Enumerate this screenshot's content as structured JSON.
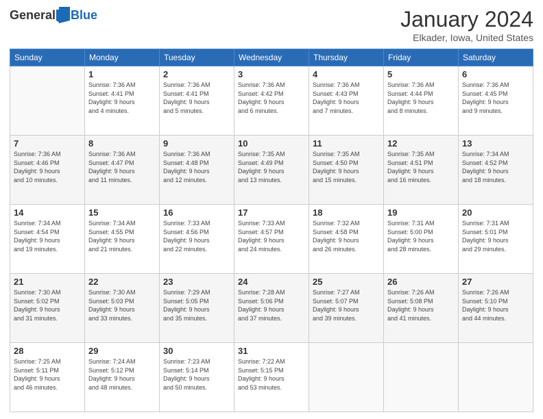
{
  "header": {
    "logo_general": "General",
    "logo_blue": "Blue",
    "month_title": "January 2024",
    "location": "Elkader, Iowa, United States"
  },
  "days_of_week": [
    "Sunday",
    "Monday",
    "Tuesday",
    "Wednesday",
    "Thursday",
    "Friday",
    "Saturday"
  ],
  "weeks": [
    [
      {
        "num": "",
        "info": ""
      },
      {
        "num": "1",
        "info": "Sunrise: 7:36 AM\nSunset: 4:41 PM\nDaylight: 9 hours\nand 4 minutes."
      },
      {
        "num": "2",
        "info": "Sunrise: 7:36 AM\nSunset: 4:41 PM\nDaylight: 9 hours\nand 5 minutes."
      },
      {
        "num": "3",
        "info": "Sunrise: 7:36 AM\nSunset: 4:42 PM\nDaylight: 9 hours\nand 6 minutes."
      },
      {
        "num": "4",
        "info": "Sunrise: 7:36 AM\nSunset: 4:43 PM\nDaylight: 9 hours\nand 7 minutes."
      },
      {
        "num": "5",
        "info": "Sunrise: 7:36 AM\nSunset: 4:44 PM\nDaylight: 9 hours\nand 8 minutes."
      },
      {
        "num": "6",
        "info": "Sunrise: 7:36 AM\nSunset: 4:45 PM\nDaylight: 9 hours\nand 9 minutes."
      }
    ],
    [
      {
        "num": "7",
        "info": "Sunrise: 7:36 AM\nSunset: 4:46 PM\nDaylight: 9 hours\nand 10 minutes."
      },
      {
        "num": "8",
        "info": "Sunrise: 7:36 AM\nSunset: 4:47 PM\nDaylight: 9 hours\nand 11 minutes."
      },
      {
        "num": "9",
        "info": "Sunrise: 7:36 AM\nSunset: 4:48 PM\nDaylight: 9 hours\nand 12 minutes."
      },
      {
        "num": "10",
        "info": "Sunrise: 7:35 AM\nSunset: 4:49 PM\nDaylight: 9 hours\nand 13 minutes."
      },
      {
        "num": "11",
        "info": "Sunrise: 7:35 AM\nSunset: 4:50 PM\nDaylight: 9 hours\nand 15 minutes."
      },
      {
        "num": "12",
        "info": "Sunrise: 7:35 AM\nSunset: 4:51 PM\nDaylight: 9 hours\nand 16 minutes."
      },
      {
        "num": "13",
        "info": "Sunrise: 7:34 AM\nSunset: 4:52 PM\nDaylight: 9 hours\nand 18 minutes."
      }
    ],
    [
      {
        "num": "14",
        "info": "Sunrise: 7:34 AM\nSunset: 4:54 PM\nDaylight: 9 hours\nand 19 minutes."
      },
      {
        "num": "15",
        "info": "Sunrise: 7:34 AM\nSunset: 4:55 PM\nDaylight: 9 hours\nand 21 minutes."
      },
      {
        "num": "16",
        "info": "Sunrise: 7:33 AM\nSunset: 4:56 PM\nDaylight: 9 hours\nand 22 minutes."
      },
      {
        "num": "17",
        "info": "Sunrise: 7:33 AM\nSunset: 4:57 PM\nDaylight: 9 hours\nand 24 minutes."
      },
      {
        "num": "18",
        "info": "Sunrise: 7:32 AM\nSunset: 4:58 PM\nDaylight: 9 hours\nand 26 minutes."
      },
      {
        "num": "19",
        "info": "Sunrise: 7:31 AM\nSunset: 5:00 PM\nDaylight: 9 hours\nand 28 minutes."
      },
      {
        "num": "20",
        "info": "Sunrise: 7:31 AM\nSunset: 5:01 PM\nDaylight: 9 hours\nand 29 minutes."
      }
    ],
    [
      {
        "num": "21",
        "info": "Sunrise: 7:30 AM\nSunset: 5:02 PM\nDaylight: 9 hours\nand 31 minutes."
      },
      {
        "num": "22",
        "info": "Sunrise: 7:30 AM\nSunset: 5:03 PM\nDaylight: 9 hours\nand 33 minutes."
      },
      {
        "num": "23",
        "info": "Sunrise: 7:29 AM\nSunset: 5:05 PM\nDaylight: 9 hours\nand 35 minutes."
      },
      {
        "num": "24",
        "info": "Sunrise: 7:28 AM\nSunset: 5:06 PM\nDaylight: 9 hours\nand 37 minutes."
      },
      {
        "num": "25",
        "info": "Sunrise: 7:27 AM\nSunset: 5:07 PM\nDaylight: 9 hours\nand 39 minutes."
      },
      {
        "num": "26",
        "info": "Sunrise: 7:26 AM\nSunset: 5:08 PM\nDaylight: 9 hours\nand 41 minutes."
      },
      {
        "num": "27",
        "info": "Sunrise: 7:26 AM\nSunset: 5:10 PM\nDaylight: 9 hours\nand 44 minutes."
      }
    ],
    [
      {
        "num": "28",
        "info": "Sunrise: 7:25 AM\nSunset: 5:11 PM\nDaylight: 9 hours\nand 46 minutes."
      },
      {
        "num": "29",
        "info": "Sunrise: 7:24 AM\nSunset: 5:12 PM\nDaylight: 9 hours\nand 48 minutes."
      },
      {
        "num": "30",
        "info": "Sunrise: 7:23 AM\nSunset: 5:14 PM\nDaylight: 9 hours\nand 50 minutes."
      },
      {
        "num": "31",
        "info": "Sunrise: 7:22 AM\nSunset: 5:15 PM\nDaylight: 9 hours\nand 53 minutes."
      },
      {
        "num": "",
        "info": ""
      },
      {
        "num": "",
        "info": ""
      },
      {
        "num": "",
        "info": ""
      }
    ]
  ]
}
